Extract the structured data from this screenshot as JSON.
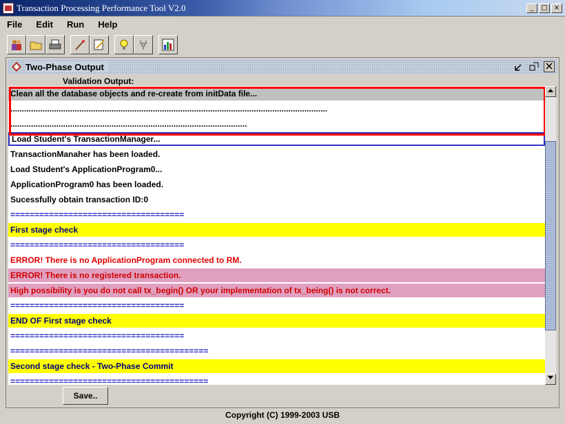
{
  "window": {
    "title": "Transaction Processing Performance Tool V2.0",
    "controls": {
      "minimize": "_",
      "maximize": "□",
      "close": "×"
    }
  },
  "menu": [
    "File",
    "Edit",
    "Run",
    "Help"
  ],
  "toolbar": {
    "icons": [
      "people-icon",
      "open-folder-icon",
      "print-icon",
      "wand-icon",
      "edit-icon",
      "lightbulb-icon",
      "plug-icon",
      "chart-icon"
    ]
  },
  "panel": {
    "title": "Two-Phase Output",
    "label": "Validation Output:",
    "save_label": "Save.."
  },
  "output_lines": [
    {
      "text": "Clean all the database objects and re-create from initData file...",
      "style": "gray"
    },
    {
      "text": "..........................................................................................................................................",
      "style": "normal"
    },
    {
      "text": ".......................................................................................................",
      "style": "normal"
    },
    {
      "text": "Load Student's TransactionManager...",
      "style": "selected"
    },
    {
      "text": "TransactionManaher has been loaded.",
      "style": "normal"
    },
    {
      "text": "Load Student's ApplicationProgram0...",
      "style": "normal"
    },
    {
      "text": "ApplicationProgram0 has been loaded.",
      "style": "normal"
    },
    {
      "text": "Sucessfully obtain transaction ID:0",
      "style": "normal"
    },
    {
      "text": "====================================",
      "style": "sep"
    },
    {
      "text": "First stage check",
      "style": "yellow"
    },
    {
      "text": "====================================",
      "style": "sep"
    },
    {
      "text": "ERROR! There is no ApplicationProgram connected to RM.",
      "style": "red"
    },
    {
      "text": "ERROR! There is no registered transaction.",
      "style": "pink"
    },
    {
      "text": "High possibility is you do not call tx_begin() OR your implementation of tx_being() is not correct.",
      "style": "pink"
    },
    {
      "text": "====================================",
      "style": "sep"
    },
    {
      "text": "END OF First stage check",
      "style": "yellow"
    },
    {
      "text": "====================================",
      "style": "sep"
    },
    {
      "text": "=========================================",
      "style": "sep"
    },
    {
      "text": "Second stage check - Two-Phase Commit",
      "style": "yellow"
    },
    {
      "text": "=========================================",
      "style": "sep"
    }
  ],
  "footer": {
    "copyright": "Copyright (C) 1999-2003 USB"
  }
}
